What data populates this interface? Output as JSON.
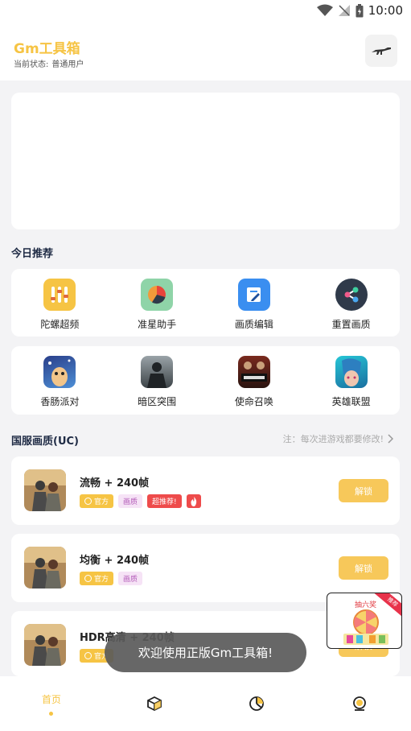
{
  "status_bar": {
    "time": "10:00"
  },
  "header": {
    "title": "Gm工具箱",
    "status_label": "当前状态:",
    "status_value": "普通用户"
  },
  "today_section": {
    "title": "今日推荐"
  },
  "tools": [
    {
      "label": "陀螺超频",
      "icon": "gyroscope-bars-icon"
    },
    {
      "label": "准星助手",
      "icon": "crosshair-pie-icon"
    },
    {
      "label": "画质编辑",
      "icon": "edit-document-icon"
    },
    {
      "label": "重置画质",
      "icon": "share-icon"
    }
  ],
  "games": [
    {
      "label": "香肠派对",
      "icon": "sausage-party-icon"
    },
    {
      "label": "暗区突围",
      "icon": "arena-breakout-icon"
    },
    {
      "label": "使命召唤",
      "icon": "call-of-duty-icon"
    },
    {
      "label": "英雄联盟",
      "icon": "league-of-legends-icon"
    }
  ],
  "uc_section": {
    "title": "国服画质(UC)",
    "note": "注：每次进游戏都要修改!"
  },
  "presets": [
    {
      "title": "流畅 + 240帧",
      "tags": [
        "官方",
        "画质",
        "超推荐!"
      ],
      "hot": true,
      "button": "解锁"
    },
    {
      "title": "均衡 + 240帧",
      "tags": [
        "官方",
        "画质"
      ],
      "hot": false,
      "button": "解锁"
    },
    {
      "title": "HDR高清 + 240帧",
      "tags": [
        "官方"
      ],
      "hot": false,
      "button": "解锁"
    }
  ],
  "promo": {
    "title": "抽六奖",
    "ribbon": "推荐"
  },
  "toast": "欢迎使用正版Gm工具箱!",
  "tabbar": {
    "home_label": "首页"
  },
  "colors": {
    "accent": "#f6c444",
    "hot": "#ee4b4b",
    "quality_tag": "#f6e3f6"
  }
}
